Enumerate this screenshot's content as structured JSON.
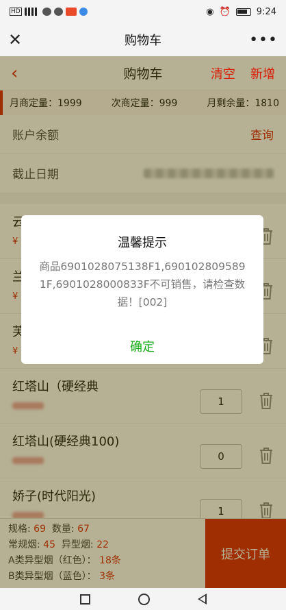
{
  "status_bar": {
    "left": "HD",
    "time": "9:24"
  },
  "webview": {
    "title": "购物车",
    "close_icon": "close-icon",
    "more": "•••"
  },
  "header": {
    "back": "‹",
    "title": "购物车",
    "clear_label": "清空",
    "add_label": "新增"
  },
  "quota": {
    "monthly": "月商定量：1999",
    "next": "次商定量：999",
    "remaining": "月剩余量：1810"
  },
  "account": {
    "balance_label": "账户余额",
    "query_label": "查询",
    "deadline_label": "截止日期"
  },
  "items": [
    {
      "name": "云",
      "price": "¥",
      "qty": ""
    },
    {
      "name": "兰",
      "price": "¥",
      "qty": ""
    },
    {
      "name": "芙",
      "price": "¥",
      "qty": ""
    },
    {
      "name": "红塔山（硬经典",
      "price": "",
      "qty": "1"
    },
    {
      "name": "红塔山(硬经典100)",
      "price": "",
      "qty": "0"
    },
    {
      "name": "娇子(时代阳光)",
      "price": "",
      "qty": "1"
    }
  ],
  "summary": {
    "spec_label": "规格:",
    "spec_value": "69",
    "qty_label": "数量:",
    "qty_value": "67",
    "regular_label": "常规烟:",
    "regular_value": "45",
    "special_label": "异型烟:",
    "special_value": "22",
    "class_a_label": "A类异型烟（红色）：",
    "class_a_value": "18条",
    "class_b_label": "B类异型烟（蓝色）：",
    "class_b_value": "3条",
    "submit_label": "提交订单"
  },
  "dialog": {
    "title": "温馨提示",
    "message": "商品6901028075138F1,6901028095891F,6901028000833F不可销售，请检查数据！[002]",
    "confirm_label": "确定"
  },
  "colors": {
    "accent": "#d81e06",
    "confirm": "#1aad19",
    "overlay": "rgba(80,70,0,0.42)"
  }
}
